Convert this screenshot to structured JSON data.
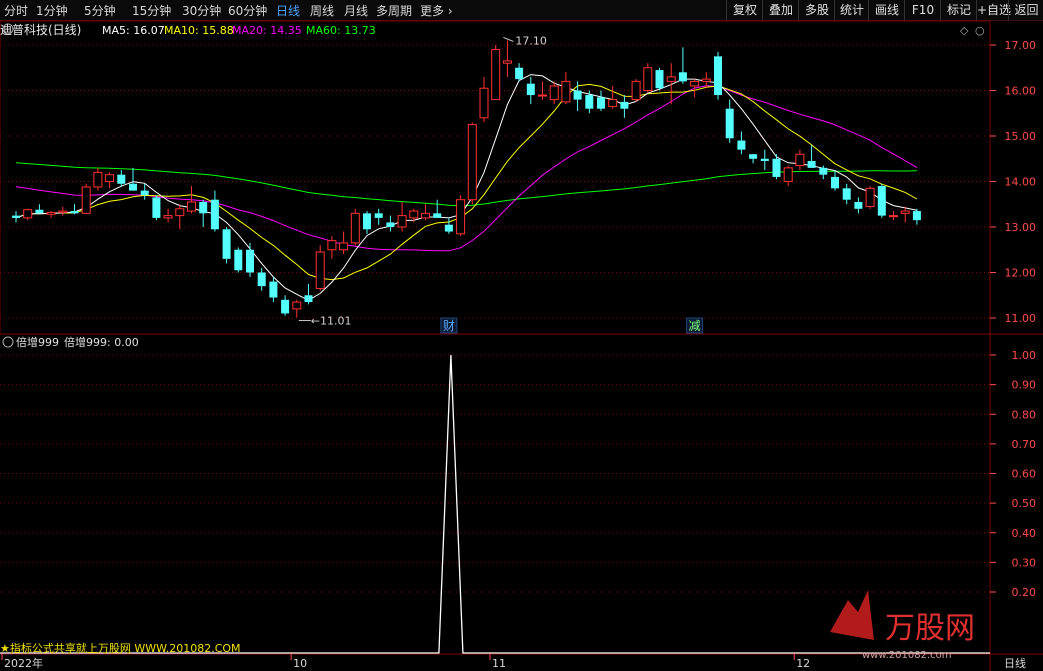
{
  "toolbar": {
    "tabs": [
      "分时",
      "1分钟",
      "5分钟",
      "15分钟",
      "30分钟",
      "60分钟",
      "日线",
      "周线",
      "月线",
      "多周期",
      "更多"
    ],
    "active_tab": "日线",
    "right_buttons": [
      "复权",
      "叠加",
      "多股",
      "统计",
      "画线",
      "F10",
      "标记",
      "+自选",
      "返回"
    ]
  },
  "main_panel": {
    "stock_title": "迪普科技(日线)",
    "ma_legend": [
      {
        "label": "MA5: 16.07",
        "color": "#ffffff"
      },
      {
        "label": "MA10: 15.88",
        "color": "#ffff00"
      },
      {
        "label": "MA20: 14.35",
        "color": "#ff00ff"
      },
      {
        "label": "MA60: 13.73",
        "color": "#00ff00"
      }
    ],
    "price_axis_labels": [
      "17.00",
      "16.00",
      "15.00",
      "14.00",
      "13.00",
      "12.00",
      "11.00"
    ],
    "high_marker": "17.10",
    "low_marker": "11.01",
    "event_markers": [
      "财",
      "减"
    ]
  },
  "indicator_panel": {
    "title": "倍增999",
    "value_label": "倍增999: 0.00",
    "axis_labels": [
      "1.00",
      "0.90",
      "0.80",
      "0.70",
      "0.60",
      "0.50",
      "0.40",
      "0.30",
      "0.20"
    ]
  },
  "time_axis": {
    "labels": [
      "2022年",
      "10",
      "11",
      "12"
    ],
    "period_label": "日线"
  },
  "watermark": {
    "left_text": "★指标公式共享就上万股网 WWW.201082.COM",
    "logo_text": "万股网",
    "logo_url": "www.201082.com"
  },
  "colors": {
    "up": "#ff3232",
    "down": "#54ffff",
    "grid": "#7a0000",
    "axis_text": "#ff4c4c"
  },
  "chart_data": {
    "type": "candlestick",
    "price_ylim": [
      10.85,
      17.5
    ],
    "indicator_ylim": [
      0.1,
      1.05
    ],
    "candles": [
      {
        "o": 13.25,
        "h": 13.35,
        "l": 13.1,
        "c": 13.2
      },
      {
        "o": 13.2,
        "h": 13.4,
        "l": 13.15,
        "c": 13.38
      },
      {
        "o": 13.38,
        "h": 13.5,
        "l": 13.3,
        "c": 13.3
      },
      {
        "o": 13.28,
        "h": 13.35,
        "l": 13.2,
        "c": 13.32
      },
      {
        "o": 13.32,
        "h": 13.45,
        "l": 13.25,
        "c": 13.35
      },
      {
        "o": 13.35,
        "h": 13.5,
        "l": 13.28,
        "c": 13.3
      },
      {
        "o": 13.3,
        "h": 13.95,
        "l": 13.28,
        "c": 13.88
      },
      {
        "o": 13.88,
        "h": 14.3,
        "l": 13.8,
        "c": 14.2
      },
      {
        "o": 14.0,
        "h": 14.2,
        "l": 13.85,
        "c": 14.15
      },
      {
        "o": 14.15,
        "h": 14.25,
        "l": 13.9,
        "c": 13.95
      },
      {
        "o": 13.95,
        "h": 14.3,
        "l": 13.8,
        "c": 13.8
      },
      {
        "o": 13.8,
        "h": 13.95,
        "l": 13.6,
        "c": 13.7
      },
      {
        "o": 13.65,
        "h": 13.7,
        "l": 13.15,
        "c": 13.2
      },
      {
        "o": 13.2,
        "h": 13.4,
        "l": 13.1,
        "c": 13.25
      },
      {
        "o": 13.25,
        "h": 13.5,
        "l": 12.95,
        "c": 13.4
      },
      {
        "o": 13.35,
        "h": 13.9,
        "l": 13.3,
        "c": 13.55
      },
      {
        "o": 13.55,
        "h": 13.6,
        "l": 13.0,
        "c": 13.3
      },
      {
        "o": 13.6,
        "h": 13.8,
        "l": 12.9,
        "c": 12.95
      },
      {
        "o": 12.95,
        "h": 13.0,
        "l": 12.2,
        "c": 12.3
      },
      {
        "o": 12.5,
        "h": 12.55,
        "l": 12.0,
        "c": 12.05
      },
      {
        "o": 12.5,
        "h": 12.65,
        "l": 11.9,
        "c": 12.0
      },
      {
        "o": 12.0,
        "h": 12.1,
        "l": 11.6,
        "c": 11.7
      },
      {
        "o": 11.8,
        "h": 11.9,
        "l": 11.35,
        "c": 11.45
      },
      {
        "o": 11.4,
        "h": 11.5,
        "l": 11.05,
        "c": 11.1
      },
      {
        "o": 11.2,
        "h": 11.4,
        "l": 11.01,
        "c": 11.35
      },
      {
        "o": 11.5,
        "h": 11.75,
        "l": 11.3,
        "c": 11.35
      },
      {
        "o": 11.65,
        "h": 12.6,
        "l": 11.6,
        "c": 12.45
      },
      {
        "o": 12.5,
        "h": 12.8,
        "l": 12.3,
        "c": 12.7
      },
      {
        "o": 12.5,
        "h": 12.9,
        "l": 12.4,
        "c": 12.65
      },
      {
        "o": 12.65,
        "h": 13.4,
        "l": 12.6,
        "c": 13.3
      },
      {
        "o": 13.3,
        "h": 13.35,
        "l": 12.85,
        "c": 12.95
      },
      {
        "o": 13.3,
        "h": 13.4,
        "l": 13.05,
        "c": 13.2
      },
      {
        "o": 13.1,
        "h": 13.25,
        "l": 12.9,
        "c": 13.0
      },
      {
        "o": 13.0,
        "h": 13.55,
        "l": 12.9,
        "c": 13.25
      },
      {
        "o": 13.2,
        "h": 13.4,
        "l": 13.1,
        "c": 13.35
      },
      {
        "o": 13.2,
        "h": 13.5,
        "l": 13.15,
        "c": 13.3
      },
      {
        "o": 13.3,
        "h": 13.6,
        "l": 13.2,
        "c": 13.2
      },
      {
        "o": 13.05,
        "h": 13.2,
        "l": 12.85,
        "c": 12.9
      },
      {
        "o": 12.85,
        "h": 13.7,
        "l": 12.8,
        "c": 13.6
      },
      {
        "o": 13.6,
        "h": 15.3,
        "l": 13.5,
        "c": 15.25
      },
      {
        "o": 15.4,
        "h": 16.3,
        "l": 15.3,
        "c": 16.05
      },
      {
        "o": 15.8,
        "h": 17.0,
        "l": 15.8,
        "c": 16.9
      },
      {
        "o": 16.6,
        "h": 17.1,
        "l": 16.3,
        "c": 16.65
      },
      {
        "o": 16.5,
        "h": 16.6,
        "l": 16.2,
        "c": 16.25
      },
      {
        "o": 16.15,
        "h": 16.3,
        "l": 15.7,
        "c": 15.9
      },
      {
        "o": 15.9,
        "h": 16.2,
        "l": 15.8,
        "c": 15.9
      },
      {
        "o": 15.8,
        "h": 16.2,
        "l": 15.7,
        "c": 16.1
      },
      {
        "o": 15.75,
        "h": 16.4,
        "l": 15.7,
        "c": 16.2
      },
      {
        "o": 16.0,
        "h": 16.2,
        "l": 15.55,
        "c": 15.8
      },
      {
        "o": 15.9,
        "h": 16.0,
        "l": 15.5,
        "c": 15.6
      },
      {
        "o": 15.85,
        "h": 16.0,
        "l": 15.55,
        "c": 15.6
      },
      {
        "o": 15.65,
        "h": 16.1,
        "l": 15.6,
        "c": 15.8
      },
      {
        "o": 15.75,
        "h": 15.9,
        "l": 15.4,
        "c": 15.6
      },
      {
        "o": 15.8,
        "h": 16.25,
        "l": 15.75,
        "c": 16.2
      },
      {
        "o": 16.0,
        "h": 16.6,
        "l": 15.95,
        "c": 16.5
      },
      {
        "o": 16.45,
        "h": 16.5,
        "l": 16.0,
        "c": 16.05
      },
      {
        "o": 16.2,
        "h": 16.6,
        "l": 15.7,
        "c": 16.3
      },
      {
        "o": 16.4,
        "h": 16.95,
        "l": 16.15,
        "c": 16.2
      },
      {
        "o": 16.1,
        "h": 16.25,
        "l": 15.85,
        "c": 16.2
      },
      {
        "o": 16.2,
        "h": 16.4,
        "l": 16.05,
        "c": 16.25
      },
      {
        "o": 16.75,
        "h": 16.85,
        "l": 15.8,
        "c": 15.9
      },
      {
        "o": 15.6,
        "h": 15.8,
        "l": 14.85,
        "c": 14.95
      },
      {
        "o": 14.9,
        "h": 15.1,
        "l": 14.6,
        "c": 14.7
      },
      {
        "o": 14.6,
        "h": 14.6,
        "l": 14.4,
        "c": 14.5
      },
      {
        "o": 14.5,
        "h": 14.7,
        "l": 14.25,
        "c": 14.45
      },
      {
        "o": 14.5,
        "h": 14.6,
        "l": 14.05,
        "c": 14.1
      },
      {
        "o": 14.0,
        "h": 14.35,
        "l": 13.9,
        "c": 14.3
      },
      {
        "o": 14.35,
        "h": 14.7,
        "l": 14.25,
        "c": 14.6
      },
      {
        "o": 14.45,
        "h": 14.8,
        "l": 14.3,
        "c": 14.3
      },
      {
        "o": 14.3,
        "h": 14.35,
        "l": 14.05,
        "c": 14.15
      },
      {
        "o": 14.1,
        "h": 14.25,
        "l": 13.8,
        "c": 13.85
      },
      {
        "o": 13.85,
        "h": 13.95,
        "l": 13.5,
        "c": 13.6
      },
      {
        "o": 13.55,
        "h": 13.65,
        "l": 13.3,
        "c": 13.4
      },
      {
        "o": 13.45,
        "h": 13.9,
        "l": 13.4,
        "c": 13.85
      },
      {
        "o": 13.9,
        "h": 13.95,
        "l": 13.2,
        "c": 13.25
      },
      {
        "o": 13.25,
        "h": 13.35,
        "l": 13.15,
        "c": 13.25
      },
      {
        "o": 13.3,
        "h": 13.45,
        "l": 13.1,
        "c": 13.35
      },
      {
        "o": 13.35,
        "h": 13.4,
        "l": 13.05,
        "c": 13.15
      }
    ],
    "indicator_spike_index": 37,
    "indicator_values_note_free": [
      0,
      1.0,
      0
    ],
    "event_marker_indices": [
      37,
      58
    ],
    "time_label_indices": [
      0,
      23,
      40,
      66
    ]
  }
}
